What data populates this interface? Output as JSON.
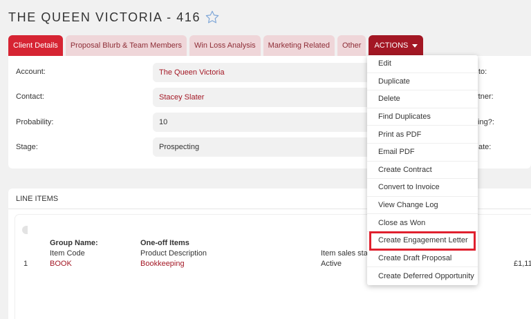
{
  "header": {
    "title": "THE QUEEN VICTORIA - 416"
  },
  "tabs": [
    {
      "label": "Client Details"
    },
    {
      "label": "Proposal Blurb & Team Members"
    },
    {
      "label": "Win Loss Analysis"
    },
    {
      "label": "Marketing Related"
    },
    {
      "label": "Other"
    },
    {
      "label": "ACTIONS"
    }
  ],
  "details": {
    "account_label": "Account:",
    "account_value": "The Queen Victoria",
    "contact_label": "Contact:",
    "contact_value": "Stacey Slater",
    "probability_label": "Probability:",
    "probability_value": "10",
    "stage_label": "Stage:",
    "stage_value": "Prospecting",
    "right_labels": [
      "to:",
      "rtner:",
      "ting?:",
      "ate:"
    ]
  },
  "actions_menu": {
    "items": [
      "Edit",
      "Duplicate",
      "Delete",
      "Find Duplicates",
      "Print as PDF",
      "Email PDF",
      "Create Contract",
      "Convert to Invoice",
      "View Change Log",
      "Close as Won",
      "Create Engagement Letter",
      "Create Draft Proposal",
      "Create Deferred Opportunity"
    ],
    "highlighted": "Create Engagement Letter"
  },
  "line_items": {
    "header": "LINE ITEMS",
    "group_name_label": "Group Name:",
    "group_name_value": "One-off Items",
    "col_item_code": "Item Code",
    "col_product_description": "Product Description",
    "col_item_sales_stage": "Item sales stag",
    "row": {
      "index": "1",
      "item_code": "BOOK",
      "product_description": "Bookkeeping",
      "status": "Active",
      "amount": "£1,11"
    }
  },
  "colors": {
    "tab_active": "#d62433",
    "tab_inactive": "#efd6d9",
    "actions_tab": "#a31724",
    "link": "#a31724",
    "highlight_outline": "#e0202e"
  }
}
